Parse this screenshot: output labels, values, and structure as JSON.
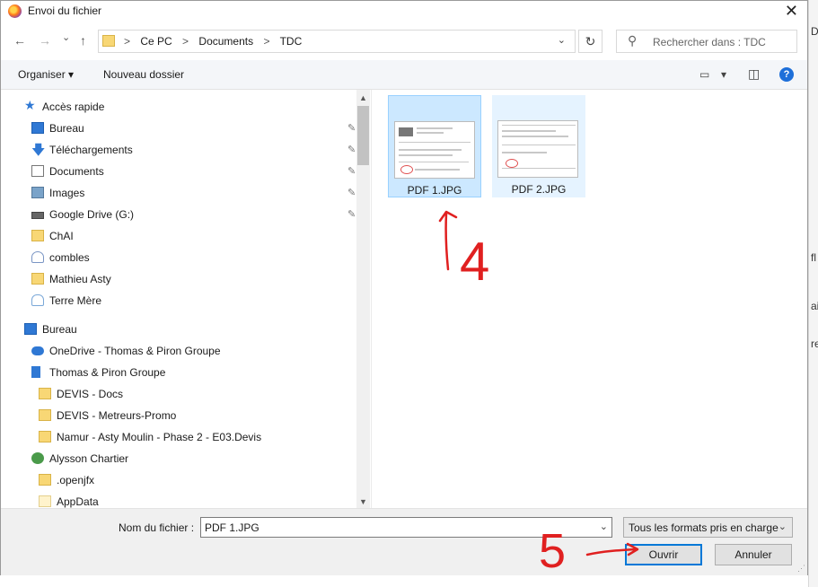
{
  "window": {
    "title": "Envoi du fichier",
    "close_glyph": "✕",
    "app_icon": "firefox-icon"
  },
  "navigation": {
    "back_glyph": "←",
    "forward_glyph": "→",
    "recent_glyph": "⌄",
    "up_glyph": "↑",
    "breadcrumb": [
      "Ce PC",
      "Documents",
      "TDC"
    ],
    "breadcrumb_separator": ">",
    "address_chevron": "⌄",
    "refresh_glyph": "↻",
    "search_placeholder": "Rechercher dans : TDC",
    "search_icon": "search-icon"
  },
  "commands": {
    "organize_label": "Organiser",
    "organize_arrow": "▾",
    "new_folder_label": "Nouveau dossier",
    "view_glyph": "▭",
    "view_arrow": "▾",
    "preview_glyph": "◫",
    "help_label": "?"
  },
  "sidebar": {
    "pin_glyph": "📌",
    "items": [
      {
        "label": "Accès rapide",
        "icon": "star-icon",
        "pinned": false
      },
      {
        "label": "Bureau",
        "icon": "desktop-icon",
        "pinned": true
      },
      {
        "label": "Téléchargements",
        "icon": "download-icon",
        "pinned": true
      },
      {
        "label": "Documents",
        "icon": "documents-icon",
        "pinned": true
      },
      {
        "label": "Images",
        "icon": "images-icon",
        "pinned": true
      },
      {
        "label": "Google Drive (G:)",
        "icon": "drive-icon",
        "pinned": true
      },
      {
        "label": "ChAI",
        "icon": "folder-icon",
        "pinned": false
      },
      {
        "label": "combles",
        "icon": "folder-icon",
        "pinned": false
      },
      {
        "label": "Mathieu Asty",
        "icon": "folder-icon",
        "pinned": false
      },
      {
        "label": "Terre Mère",
        "icon": "folder-icon",
        "pinned": false
      },
      {
        "label": "Bureau",
        "icon": "desktop-icon",
        "pinned": false
      },
      {
        "label": "OneDrive - Thomas & Piron Groupe",
        "icon": "cloud-icon",
        "pinned": false
      },
      {
        "label": "Thomas & Piron Groupe",
        "icon": "building-icon",
        "pinned": false
      },
      {
        "label": "DEVIS - Docs",
        "icon": "folder-icon",
        "pinned": false
      },
      {
        "label": "DEVIS - Metreurs-Promo",
        "icon": "folder-icon",
        "pinned": false
      },
      {
        "label": "Namur - Asty Moulin - Phase 2 - E03.Devis",
        "icon": "folder-icon",
        "pinned": false
      },
      {
        "label": "Alysson Chartier",
        "icon": "user-icon",
        "pinned": false
      },
      {
        "label": ".openjfx",
        "icon": "folder-icon",
        "pinned": false
      },
      {
        "label": "AppData",
        "icon": "folder-icon",
        "pinned": false
      }
    ]
  },
  "files": [
    {
      "name": "PDF 1.JPG",
      "selected": true
    },
    {
      "name": "PDF 2.JPG",
      "selected": false
    }
  ],
  "footer": {
    "filename_label": "Nom du fichier :",
    "filename_value": "PDF 1.JPG",
    "filetype_value": "Tous les formats pris en charge",
    "open_label": "Ouvrir",
    "cancel_label": "Annuler",
    "dropdown_chevron": "⌄",
    "resize_grip": "⋰"
  },
  "background_window": {
    "fragments": [
      "D",
      "fl",
      "aid",
      "re"
    ]
  },
  "annotations": {
    "color": "#e02020",
    "step_labels": [
      "4",
      "5"
    ]
  }
}
